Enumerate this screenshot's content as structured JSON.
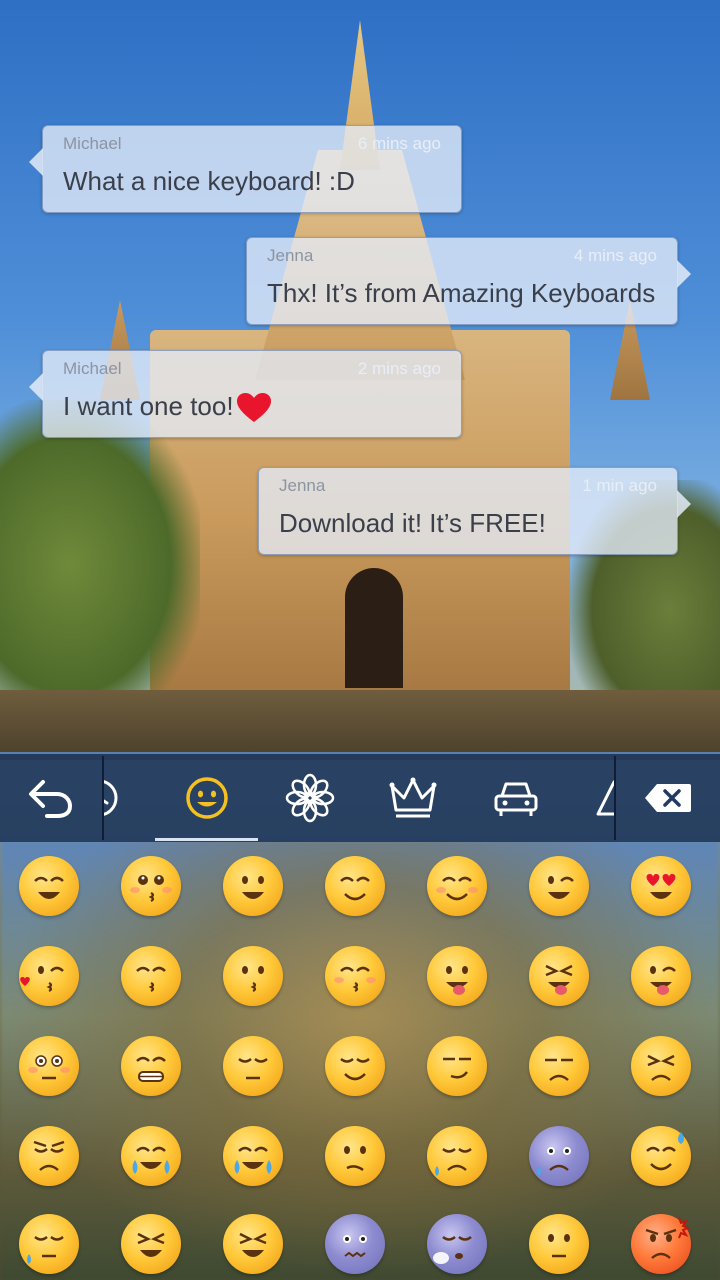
{
  "messages": [
    {
      "name": "Michael",
      "time": "6 mins ago",
      "text": "What a nice keyboard! :D",
      "side": "left"
    },
    {
      "name": "Jenna",
      "time": "4 mins ago",
      "text": "Thx! It’s from Amazing Keyboards",
      "side": "right"
    },
    {
      "name": "Michael",
      "time": "2 mins ago",
      "text": "I want one too!",
      "side": "left"
    },
    {
      "name": "Jenna",
      "time": "1 min ago",
      "text": "Download it! It’s FREE!",
      "side": "right"
    }
  ],
  "toolbar": {
    "back_icon": "undo-arrow-icon",
    "tabs": [
      {
        "icon": "recent-clock-icon"
      },
      {
        "icon": "smiley-face-icon",
        "selected": true
      },
      {
        "icon": "flower-icon"
      },
      {
        "icon": "crown-icon"
      },
      {
        "icon": "car-icon"
      },
      {
        "icon": "triangle-symbols-icon"
      }
    ],
    "delete_icon": "backspace-icon",
    "accent": "#f5c021"
  },
  "emoji_grid": {
    "rows": [
      [
        "grinning",
        "smiling-blush",
        "smiling",
        "relieved",
        "smiling-blush-eyes",
        "winking",
        "heart-eyes"
      ],
      [
        "kissing-heart",
        "kissing-closed-eyes",
        "kissing",
        "kissing-blush",
        "tongue-out",
        "tongue-squint",
        "tongue-wink"
      ],
      [
        "flushed",
        "grimacing",
        "pensive",
        "relieved-closed",
        "smirk",
        "unamused",
        "persevering"
      ],
      [
        "disappointed",
        "crying-joy",
        "loudly-crying",
        "confused",
        "disappointed-relieved",
        "fearful",
        "sweat-smile"
      ],
      [
        "cold-sweat",
        "tired",
        "tired-face",
        "confounded",
        "sleepy",
        "neutral",
        "angry"
      ]
    ]
  }
}
